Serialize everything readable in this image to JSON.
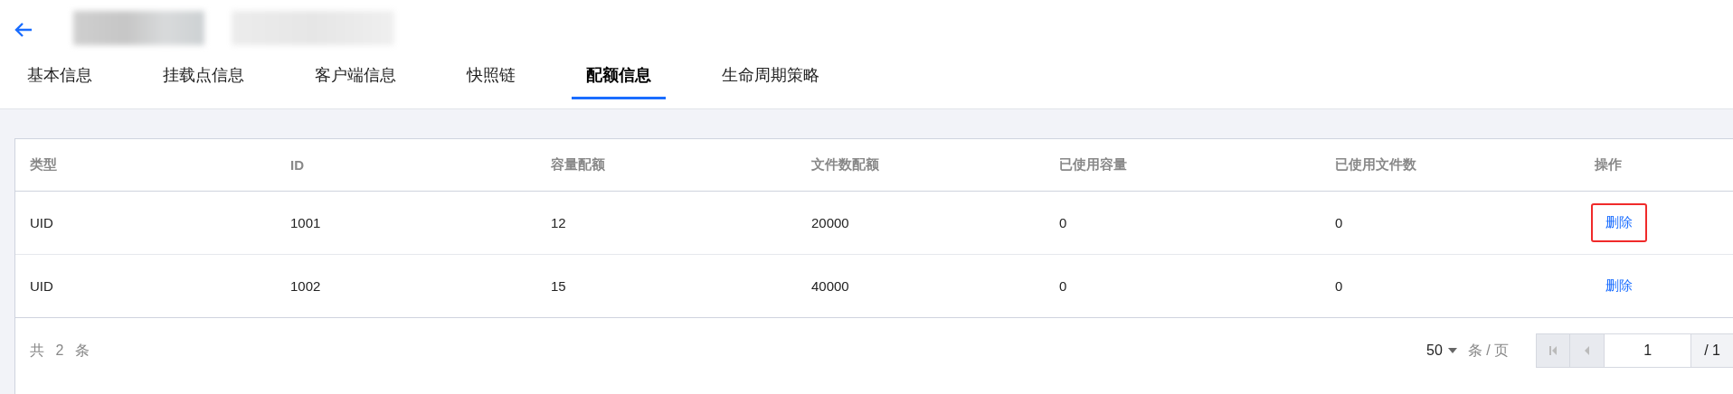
{
  "header": {
    "title_redacted": true
  },
  "tabs": [
    {
      "label": "基本信息",
      "selected": false
    },
    {
      "label": "挂载点信息",
      "selected": false
    },
    {
      "label": "客户端信息",
      "selected": false
    },
    {
      "label": "快照链",
      "selected": false
    },
    {
      "label": "配额信息",
      "selected": true
    },
    {
      "label": "生命周期策略",
      "selected": false
    }
  ],
  "table": {
    "columns": [
      "类型",
      "ID",
      "容量配额",
      "文件数配额",
      "已使用容量",
      "已使用文件数",
      "操作"
    ],
    "rows": [
      {
        "cells": [
          "UID",
          "1001",
          "12",
          "20000",
          "0",
          "0"
        ],
        "action": "删除",
        "highlighted": true
      },
      {
        "cells": [
          "UID",
          "1002",
          "15",
          "40000",
          "0",
          "0"
        ],
        "action": "删除",
        "highlighted": false
      }
    ]
  },
  "pagination": {
    "total": "共 2 条",
    "page_size": "50",
    "page_size_unit": "条 / 页",
    "page": "1",
    "page_count": "/ 1"
  }
}
